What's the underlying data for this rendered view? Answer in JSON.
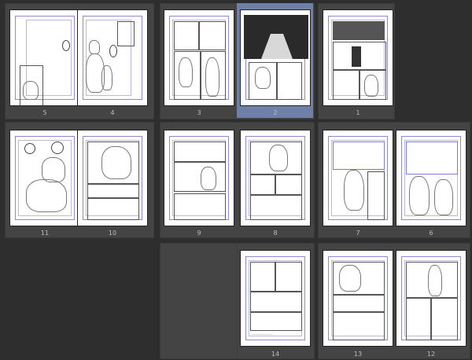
{
  "app": {
    "view": "page-manager"
  },
  "pages": [
    {
      "number": "5",
      "label": "5",
      "spread": "A",
      "selected": false
    },
    {
      "number": "4",
      "label": "4",
      "spread": "A",
      "selected": false
    },
    {
      "number": "3",
      "label": "3",
      "spread": "B",
      "selected": false
    },
    {
      "number": "2",
      "label": "2",
      "spread": "B",
      "selected": true
    },
    {
      "number": "1",
      "label": "1",
      "spread": "C",
      "selected": false
    },
    {
      "number": "11",
      "label": "11",
      "spread": "D",
      "selected": false
    },
    {
      "number": "10",
      "label": "10",
      "spread": "D",
      "selected": false
    },
    {
      "number": "9",
      "label": "9",
      "spread": "E",
      "selected": false
    },
    {
      "number": "8",
      "label": "8",
      "spread": "E",
      "selected": false
    },
    {
      "number": "7",
      "label": "7",
      "spread": "F",
      "selected": false
    },
    {
      "number": "6",
      "label": "6",
      "spread": "F",
      "selected": false
    },
    {
      "number": "14",
      "label": "14",
      "spread": "G",
      "selected": false
    },
    {
      "number": "13",
      "label": "13",
      "spread": "H",
      "selected": false
    },
    {
      "number": "12",
      "label": "12",
      "spread": "H",
      "selected": false
    }
  ],
  "labels": {
    "p5": "5",
    "p4": "4",
    "p3": "3",
    "p2": "2",
    "p1": "1",
    "p11": "11",
    "p10": "10",
    "p9": "9",
    "p8": "8",
    "p7": "7",
    "p6": "6",
    "p14": "14",
    "p13": "13",
    "p12": "12"
  },
  "colors": {
    "background": "#2e2e2e",
    "spread": "#444444",
    "selection": "#6e7fa8",
    "guides": "#6f6fd0"
  }
}
